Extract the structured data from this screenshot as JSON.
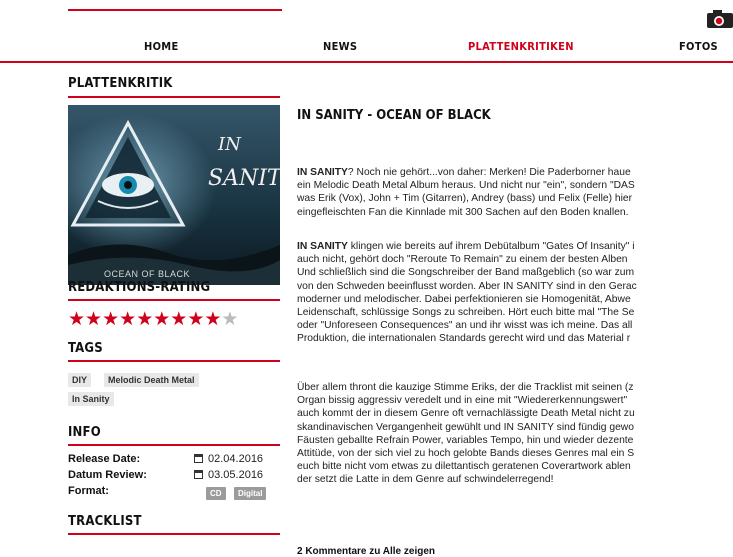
{
  "nav": {
    "items": [
      {
        "label": "HOME",
        "active": false
      },
      {
        "label": "NEWS",
        "active": false
      },
      {
        "label": "PLATTENKRITIKEN",
        "active": true
      },
      {
        "label": "FOTOS",
        "active": false
      }
    ]
  },
  "page_title": "PLATTENKRITIK",
  "cover": {
    "band_text": "IN SANITY",
    "album_text": "OCEAN OF BLACK"
  },
  "rating": {
    "heading": "REDAKTIONS-RATING",
    "stars_filled": 9,
    "stars_total": 10
  },
  "tags": {
    "heading": "TAGS",
    "items": [
      "DIY",
      "Melodic Death Metal",
      "In Sanity"
    ]
  },
  "info": {
    "heading": "INFO",
    "release_label": "Release Date:",
    "release_value": "02.04.2016",
    "review_label": "Datum Review:",
    "review_value": "03.05.2016",
    "format_label": "Format:",
    "formats": [
      "CD",
      "Digital"
    ]
  },
  "tracklist": {
    "heading": "TRACKLIST"
  },
  "article": {
    "title": "IN SANITY - OCEAN OF BLACK",
    "p1": [
      [
        "IN SANITY",
        "? Noch nie gehört...von daher: Merken! Die Paderborner haue"
      ],
      [
        "",
        "ein Melodic Death Metal Album heraus. Und nicht nur \"ein\", sondern \"DAS"
      ],
      [
        "",
        "was Erik (Vox), John + Tim (Gitarren), Andrey (bass) und Felix (Felle) hier"
      ],
      [
        "",
        "eingefleischten Fan die Kinnlade mit 300 Sachen auf den Boden knallen."
      ]
    ],
    "p2": [
      [
        "IN SANITY",
        " klingen wie bereits auf ihrem Debütalbum \"Gates Of Insanity\" i"
      ],
      [
        "",
        "auch nicht, gehört doch \"Reroute To Remain\" zu einem der besten Alben"
      ],
      [
        "",
        "Und schließlich sind die Songschreiber der Band maßgeblich (so war zum"
      ],
      [
        "",
        "von den Schweden beeinflusst worden. Aber IN SANITY sind in den Gerac"
      ],
      [
        "",
        "moderner und melodischer. Dabei perfektionieren sie Homogenität, Abwe"
      ],
      [
        "",
        "Leidenschaft, schlüssige Songs zu schreiben. Hört euch bitte mal \"The Se"
      ],
      [
        "",
        "oder \"Unforeseen Consequences\" an und ihr wisst was ich meine. Das all"
      ],
      [
        "",
        "Produktion, die internationalen Standards gerecht wird und das Material r"
      ]
    ],
    "p3": [
      [
        "",
        "Über allem thront die kauzige Stimme Eriks, der die Tracklist mit seinen (z"
      ],
      [
        "",
        "Organ bissig aggressiv veredelt und in eine mit \"Wiedererkennungswert\""
      ],
      [
        "",
        "auch kommt der in diesem Genre oft vernachlässigte Death Metal nicht zu"
      ],
      [
        "",
        "skandinavischen Vergangenheit gewühlt und IN SANITY sind fündig gewo"
      ],
      [
        "",
        "Fäusten geballte Refrain Power, variables Tempo, hin und wieder dezente"
      ],
      [
        "",
        "Attitüde, von der sich viel zu hoch gelobte Bands dieses Genres mal ein S"
      ],
      [
        "",
        "euch bitte nicht vom etwas zu dilettantisch geratenen Coverartwork ablen"
      ],
      [
        "",
        "der setzt die Latte in dem Genre auf schwindelerregend!"
      ]
    ],
    "comments_text": "2 Kommentare zu Alle zeigen"
  }
}
